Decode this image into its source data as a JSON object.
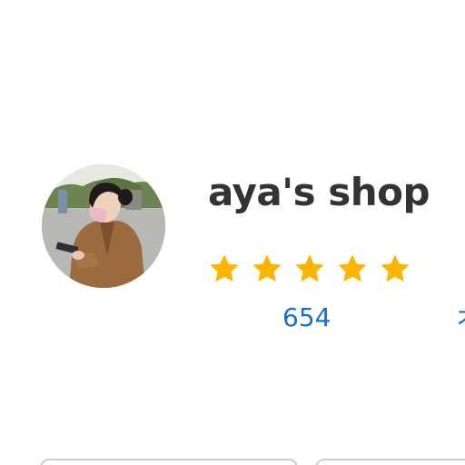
{
  "shop": {
    "name": "aya's shop",
    "rating": {
      "stars_filled": 5,
      "stars_total": 5,
      "star_color": "#FFB400",
      "review_count": "654"
    },
    "cut_off_link_text": "オ"
  },
  "colors": {
    "name_text": "#333333",
    "link": "#1A6FCF",
    "button_border": "#CCCCCC"
  },
  "icons": {
    "avatar": "shop-avatar-photo",
    "star": "star-icon"
  }
}
